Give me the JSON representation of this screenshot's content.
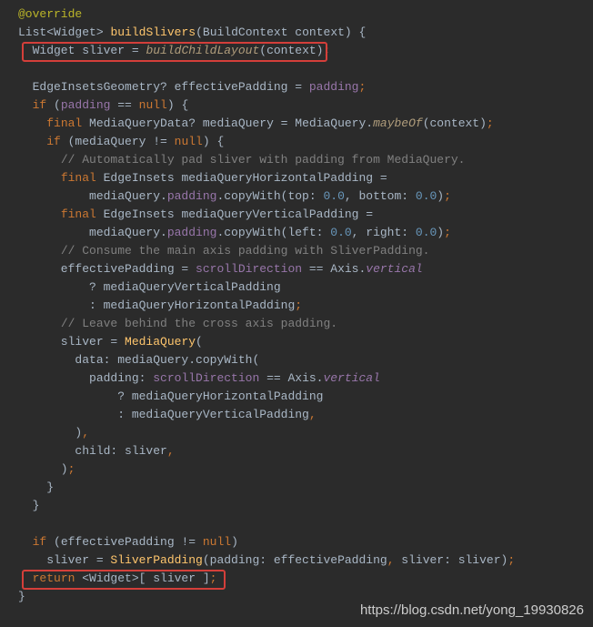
{
  "code": {
    "l1": "@override",
    "l2a": "List",
    "l2b": "<",
    "l2c": "Widget",
    "l2d": "> ",
    "l2e": "buildSlivers",
    "l2f": "(",
    "l2g": "BuildContext context",
    "l2h": ") {",
    "l3a": "  Widget sliver = ",
    "l3b": "buildChildLayout",
    "l3c": "(context)",
    "l3d": ";",
    "l4": " ",
    "l5a": "  EdgeInsetsGeometry? effectivePadding = ",
    "l5b": "padding",
    "l5c": ";",
    "l6a": "  ",
    "l6b": "if ",
    "l6c": "(",
    "l6d": "padding",
    "l6e": " == ",
    "l6f": "null",
    "l6g": ") {",
    "l7a": "    ",
    "l7b": "final ",
    "l7c": "MediaQueryData? mediaQuery = MediaQuery.",
    "l7d": "maybeOf",
    "l7e": "(context)",
    "l7f": ";",
    "l8a": "    ",
    "l8b": "if ",
    "l8c": "(mediaQuery != ",
    "l8d": "null",
    "l8e": ") {",
    "l9a": "      ",
    "l9b": "// Automatically pad sliver with padding from MediaQuery.",
    "l10a": "      ",
    "l10b": "final ",
    "l10c": "EdgeInsets mediaQueryHorizontalPadding =",
    "l11a": "          mediaQuery.",
    "l11b": "padding",
    "l11c": ".copyWith(top: ",
    "l11d": "0.0",
    "l11e": ", bottom: ",
    "l11f": "0.0",
    "l11g": ")",
    "l11h": ";",
    "l12a": "      ",
    "l12b": "final ",
    "l12c": "EdgeInsets mediaQueryVerticalPadding =",
    "l13a": "          mediaQuery.",
    "l13b": "padding",
    "l13c": ".copyWith(left: ",
    "l13d": "0.0",
    "l13e": ", right: ",
    "l13f": "0.0",
    "l13g": ")",
    "l13h": ";",
    "l14a": "      ",
    "l14b": "// Consume the main axis padding with SliverPadding.",
    "l15a": "      effectivePadding = ",
    "l15b": "scrollDirection",
    "l15c": " == Axis.",
    "l15d": "vertical",
    "l16a": "          ? mediaQueryVerticalPadding",
    "l17a": "          : mediaQueryHorizontalPadding",
    "l17b": ";",
    "l18a": "      ",
    "l18b": "// Leave behind the cross axis padding.",
    "l19a": "      sliver = ",
    "l19b": "MediaQuery",
    "l19c": "(",
    "l20a": "        data: mediaQuery.copyWith(",
    "l21a": "          padding: ",
    "l21b": "scrollDirection",
    "l21c": " == Axis.",
    "l21d": "vertical",
    "l22a": "              ? mediaQueryHorizontalPadding",
    "l23a": "              : mediaQueryVerticalPadding",
    "l23b": ",",
    "l24a": "        )",
    "l24b": ",",
    "l25a": "        child: sliver",
    "l25b": ",",
    "l26a": "      )",
    "l26b": ";",
    "l27a": "    }",
    "l28a": "  }",
    "l29": " ",
    "l30a": "  ",
    "l30b": "if ",
    "l30c": "(effectivePadding != ",
    "l30d": "null",
    "l30e": ")",
    "l31a": "    sliver = ",
    "l31b": "SliverPadding",
    "l31c": "(padding: effectivePadding",
    "l31d": ", ",
    "l31e": "sliver: sliver)",
    "l31f": ";",
    "l32a": "  ",
    "l32b": "return ",
    "l32c": "<Widget>[ sliver ]",
    "l32d": ";",
    "l33a": "}"
  },
  "url": "https://blog.csdn.net/yong_19930826"
}
